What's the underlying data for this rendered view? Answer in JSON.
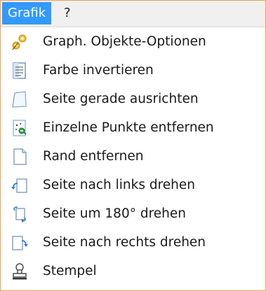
{
  "menubar": {
    "items": [
      {
        "label": "Grafik",
        "active": true
      },
      {
        "label": "?",
        "active": false
      }
    ]
  },
  "menu": {
    "items": [
      {
        "label": "Graph. Objekte-Optionen",
        "icon": "gear-options-icon"
      },
      {
        "label": "Farbe invertieren",
        "icon": "document-invert-icon"
      },
      {
        "label": "Seite gerade ausrichten",
        "icon": "page-straighten-icon"
      },
      {
        "label": "Einzelne Punkte entfernen",
        "icon": "remove-dots-icon"
      },
      {
        "label": "Rand entfernen",
        "icon": "page-border-icon"
      },
      {
        "label": "Seite nach links drehen",
        "icon": "rotate-left-icon"
      },
      {
        "label": "Seite um 180° drehen",
        "icon": "rotate-180-icon"
      },
      {
        "label": "Seite nach rechts drehen",
        "icon": "rotate-right-icon"
      },
      {
        "label": "Stempel",
        "icon": "stamp-icon"
      }
    ]
  },
  "colors": {
    "highlight": "#3399ff",
    "frame": "#f0a04b",
    "menubar_bg": "#f0f0f0"
  }
}
